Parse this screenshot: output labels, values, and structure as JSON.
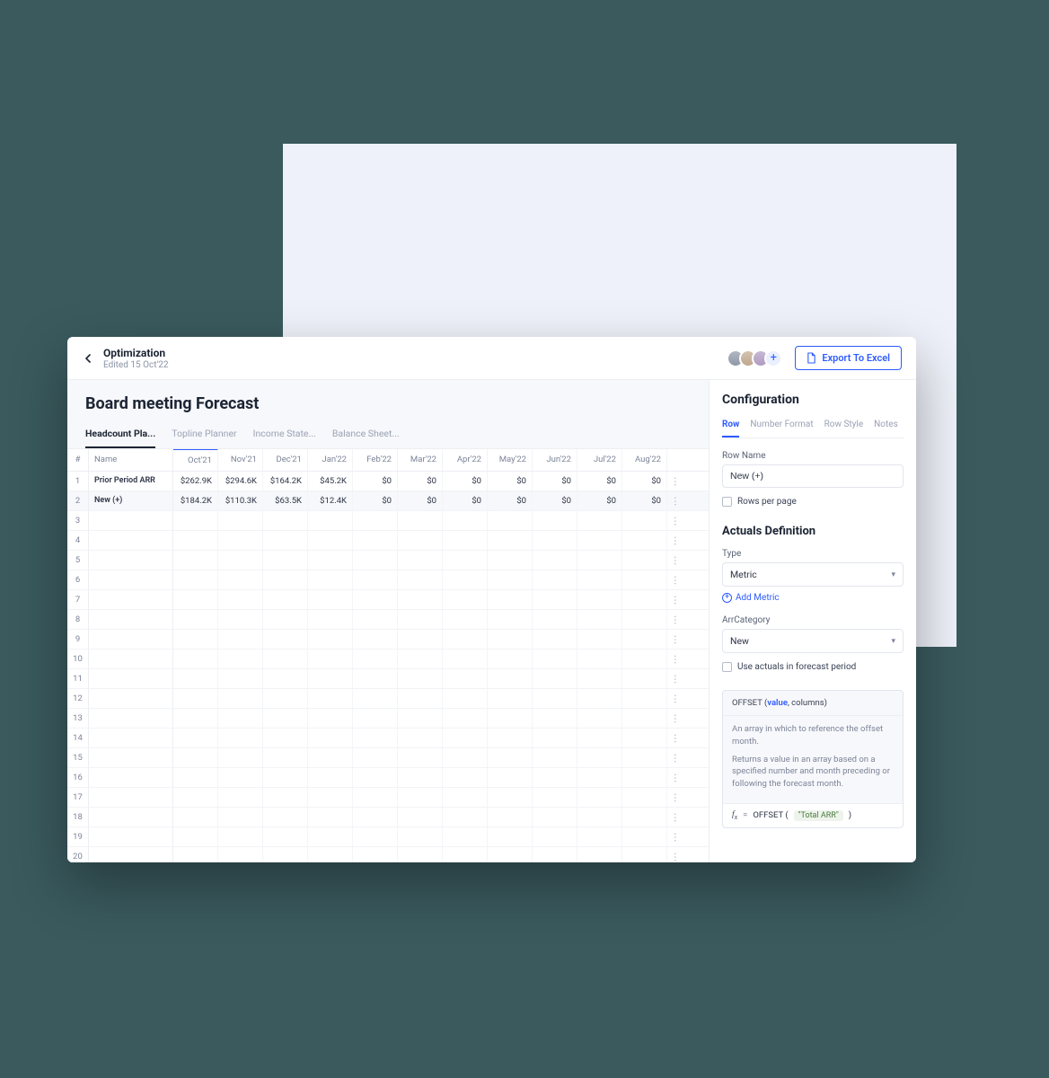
{
  "header": {
    "breadcrumb": "Optimization",
    "edited": "Edited 15 Oct'22",
    "export_label": "Export To Excel"
  },
  "page_title": "Board meeting Forecast",
  "main_tabs": [
    {
      "label": "Headcount Pla...",
      "active": true
    },
    {
      "label": "Topline Planner"
    },
    {
      "label": "Income State..."
    },
    {
      "label": "Balance Sheet..."
    }
  ],
  "grid": {
    "num_header": "#",
    "name_header": "Name",
    "months": [
      "Oct'21",
      "Nov'21",
      "Dec'21",
      "Jan'22",
      "Feb'22",
      "Mar'22",
      "Apr'22",
      "May'22",
      "Jun'22",
      "Jul'22",
      "Aug'22"
    ],
    "highlight_index": 0,
    "rows": [
      {
        "n": "1",
        "name": "Prior Period ARR",
        "cells": [
          "$262.9K",
          "$294.6K",
          "$164.2K",
          "$45.2K",
          "$0",
          "$0",
          "$0",
          "$0",
          "$0",
          "$0",
          "$0"
        ]
      },
      {
        "n": "2",
        "name": "New (+)",
        "cells": [
          "$184.2K",
          "$110.3K",
          "$63.5K",
          "$12.4K",
          "$0",
          "$0",
          "$0",
          "$0",
          "$0",
          "$0",
          "$0"
        ]
      }
    ],
    "empty_rows": [
      "3",
      "4",
      "5",
      "6",
      "7",
      "8",
      "9",
      "10",
      "11",
      "12",
      "13",
      "14",
      "15",
      "16",
      "17",
      "18",
      "19",
      "20"
    ]
  },
  "config": {
    "title": "Configuration",
    "tabs": [
      {
        "label": "Row",
        "active": true
      },
      {
        "label": "Number Format"
      },
      {
        "label": "Row Style"
      },
      {
        "label": "Notes"
      }
    ],
    "row_name_label": "Row Name",
    "row_name_value": "New (+)",
    "rows_per_page_label": "Rows per page",
    "actuals_title": "Actuals Definition",
    "type_label": "Type",
    "type_value": "Metric",
    "add_metric_label": "Add Metric",
    "arr_cat_label": "ArrCategory",
    "arr_cat_value": "New",
    "use_actuals_label": "Use actuals in forecast period",
    "formula": {
      "sig_pre": "OFFSET (",
      "sig_kw": "value",
      "sig_post": ", columns)",
      "desc1": "An array in which to reference the offset month.",
      "desc2": "Returns a value in an array based on a specified number and month preceding or following the forecast month.",
      "expr_func": "OFFSET (",
      "expr_token": "\"Total ARR\"",
      "expr_close": ")"
    }
  }
}
